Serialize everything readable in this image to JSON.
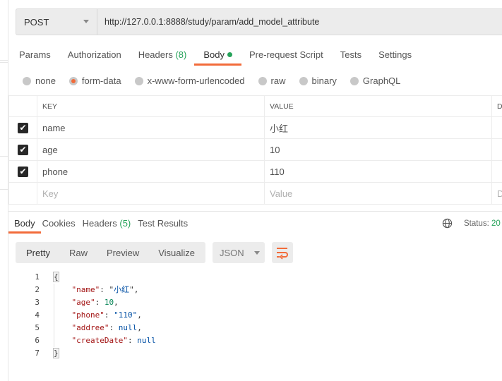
{
  "request": {
    "method": "POST",
    "url": "http://127.0.0.1:8888/study/param/add_model_attribute"
  },
  "tabs": [
    {
      "label": "Params"
    },
    {
      "label": "Authorization"
    },
    {
      "label": "Headers",
      "count": "(8)"
    },
    {
      "label": "Body",
      "active": true
    },
    {
      "label": "Pre-request Script"
    },
    {
      "label": "Tests"
    },
    {
      "label": "Settings"
    }
  ],
  "body_types": [
    {
      "label": "none"
    },
    {
      "label": "form-data",
      "selected": true
    },
    {
      "label": "x-www-form-urlencoded"
    },
    {
      "label": "raw"
    },
    {
      "label": "binary"
    },
    {
      "label": "GraphQL"
    }
  ],
  "table": {
    "headers": {
      "key": "KEY",
      "value": "VALUE",
      "desc": "DE"
    },
    "rows": [
      {
        "key": "name",
        "value": "小红",
        "checked": true
      },
      {
        "key": "age",
        "value": "10",
        "checked": true
      },
      {
        "key": "phone",
        "value": "110",
        "checked": true
      }
    ],
    "placeholder": {
      "key": "Key",
      "value": "Value",
      "desc": "D"
    }
  },
  "response": {
    "tabs": [
      {
        "label": "Body",
        "active": true
      },
      {
        "label": "Cookies"
      },
      {
        "label": "Headers",
        "count": "(5)"
      },
      {
        "label": "Test Results"
      }
    ],
    "status_label": "Status:",
    "status_value": "20",
    "views": [
      "Pretty",
      "Raw",
      "Preview",
      "Visualize"
    ],
    "format": "JSON",
    "line_numbers": [
      "1",
      "2",
      "3",
      "4",
      "5",
      "6",
      "7"
    ],
    "json": {
      "name": "小红",
      "age": "10",
      "phone": "110",
      "addree": "null",
      "createDate": "null"
    }
  },
  "colors": {
    "accent": "#f26b3a",
    "green": "#26a35a"
  }
}
